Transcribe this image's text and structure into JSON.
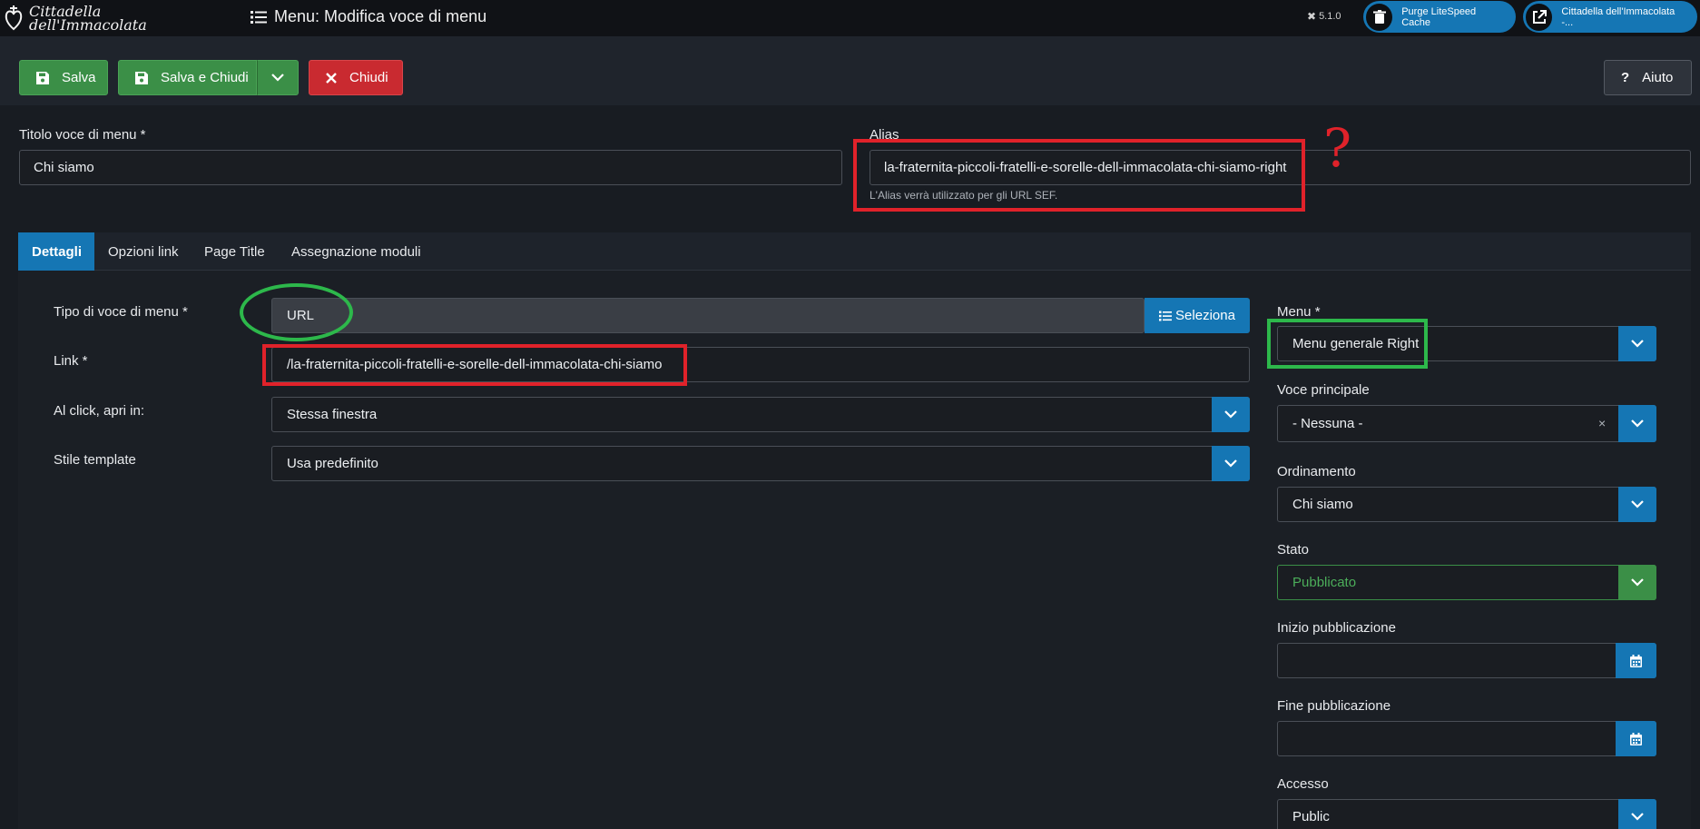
{
  "header": {
    "logo_line1": "Cittadella",
    "logo_line2": "dell'Immacolata",
    "title": "Menu: Modifica voce di menu",
    "version": "5.1.0",
    "purge_label": "Purge LiteSpeed Cache",
    "site_label": "Cittadella dell'Immacolata -..."
  },
  "toolbar": {
    "save": "Salva",
    "save_close": "Salva e Chiudi",
    "close": "Chiudi",
    "help": "Aiuto"
  },
  "form": {
    "title_label": "Titolo voce di menu *",
    "title_value": "Chi siamo",
    "alias_label": "Alias",
    "alias_value": "la-fraternita-piccoli-fratelli-e-sorelle-dell-immacolata-chi-siamo-right",
    "alias_hint": "L'Alias verrà utilizzato per gli URL SEF."
  },
  "tabs": [
    "Dettagli",
    "Opzioni link",
    "Page Title",
    "Assegnazione moduli"
  ],
  "details": {
    "type_label": "Tipo di voce di menu *",
    "type_value": "URL",
    "select_label": "Seleziona",
    "link_label": "Link *",
    "link_value": "/la-fraternita-piccoli-fratelli-e-sorelle-dell-immacolata-chi-siamo",
    "open_label": "Al click, apri in:",
    "open_value": "Stessa finestra",
    "style_label": "Stile template",
    "style_value": "Usa predefinito"
  },
  "side": {
    "menu_label": "Menu *",
    "menu_value": "Menu generale Right",
    "parent_label": "Voce principale",
    "parent_value": "- Nessuna -",
    "order_label": "Ordinamento",
    "order_value": "Chi siamo",
    "state_label": "Stato",
    "state_value": "Pubblicato",
    "start_label": "Inizio pubblicazione",
    "start_value": "",
    "end_label": "Fine pubblicazione",
    "end_value": "",
    "access_label": "Accesso",
    "access_value": "Public"
  },
  "annotation": {
    "question_mark": "?"
  },
  "colors": {
    "accent": "#1576b4",
    "success": "#3b8f47",
    "danger": "#c92a30",
    "annotation_red": "#e0222a",
    "annotation_green": "#2db84b"
  }
}
